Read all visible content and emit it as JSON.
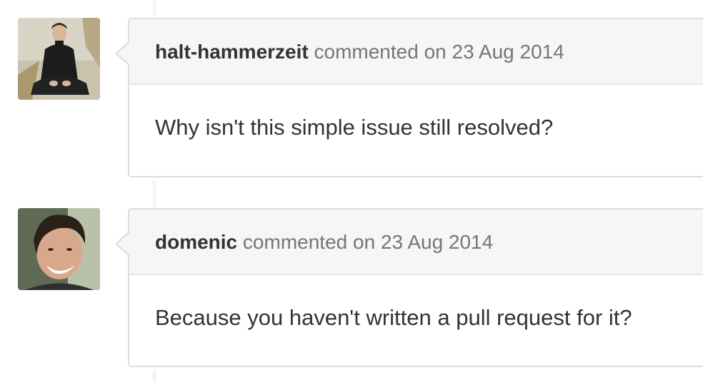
{
  "comments": [
    {
      "author": "halt-hammerzeit",
      "action": "commented",
      "date_prefix": "on",
      "date": "23 Aug 2014",
      "body": "Why isn't this simple issue still resolved?",
      "avatar_icon": "person-avatar-icon"
    },
    {
      "author": "domenic",
      "action": "commented",
      "date_prefix": "on",
      "date": "23 Aug 2014",
      "body": "Because you haven't written a pull request for it?",
      "avatar_icon": "person-avatar-icon"
    }
  ]
}
